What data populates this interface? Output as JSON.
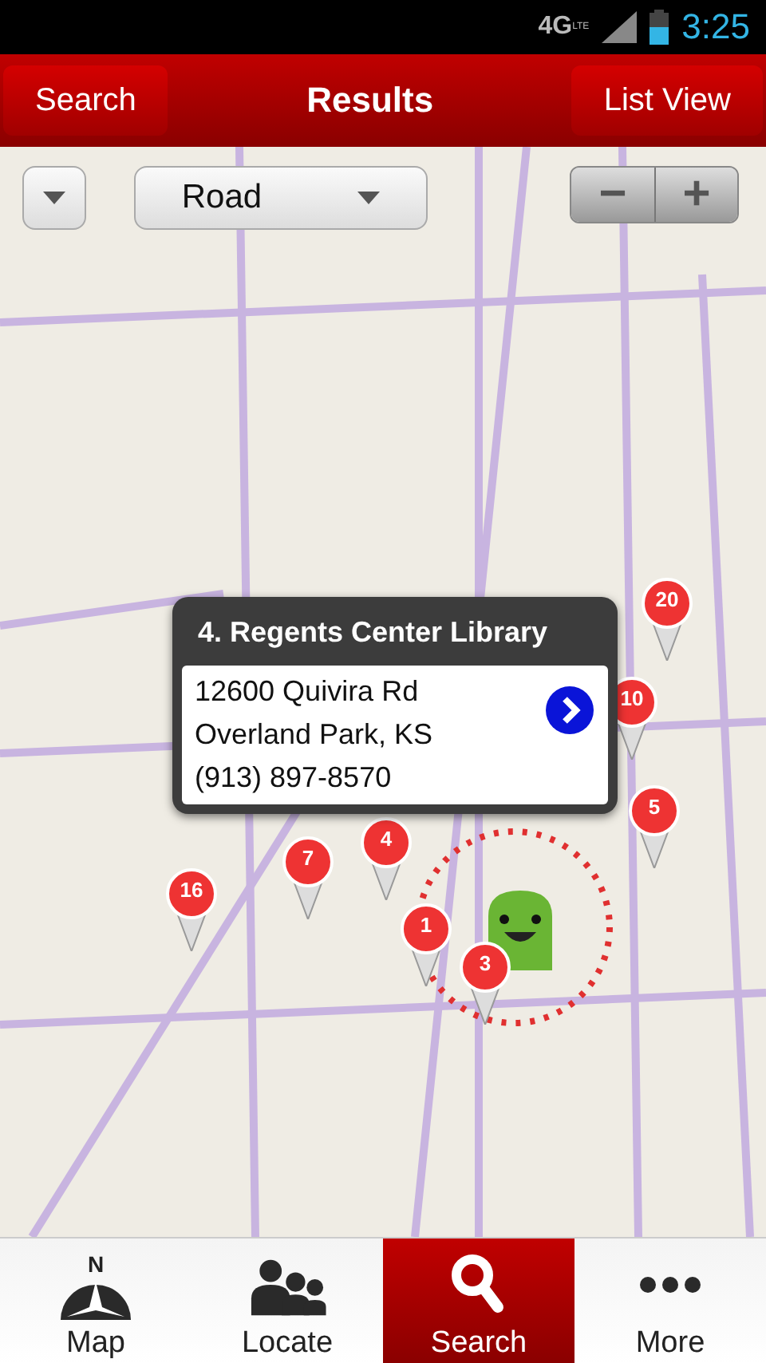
{
  "status_bar": {
    "network": "4G",
    "network_sub": "LTE",
    "time": "3:25"
  },
  "header": {
    "left_button": "Search",
    "title": "Results",
    "right_button": "List View"
  },
  "map_controls": {
    "layer_dropdown": "Road",
    "zoom_out": "−",
    "zoom_in": "+"
  },
  "pins": [
    {
      "label": "20"
    },
    {
      "label": "10"
    },
    {
      "label": "5"
    },
    {
      "label": "7"
    },
    {
      "label": "16"
    },
    {
      "label": "1"
    },
    {
      "label": "3"
    },
    {
      "label": "4"
    }
  ],
  "popup": {
    "title": "4. Regents Center Library",
    "address_line_1": "12600 Quivira Rd",
    "address_line_2": "Overland Park, KS",
    "phone": "(913) 897-8570"
  },
  "bottom_nav": [
    {
      "kind": "map",
      "label": "Map",
      "icon_letter": "N",
      "selected": false
    },
    {
      "kind": "locate",
      "label": "Locate",
      "selected": false
    },
    {
      "kind": "search",
      "label": "Search",
      "selected": true
    },
    {
      "kind": "more",
      "label": "More",
      "selected": false
    }
  ]
}
